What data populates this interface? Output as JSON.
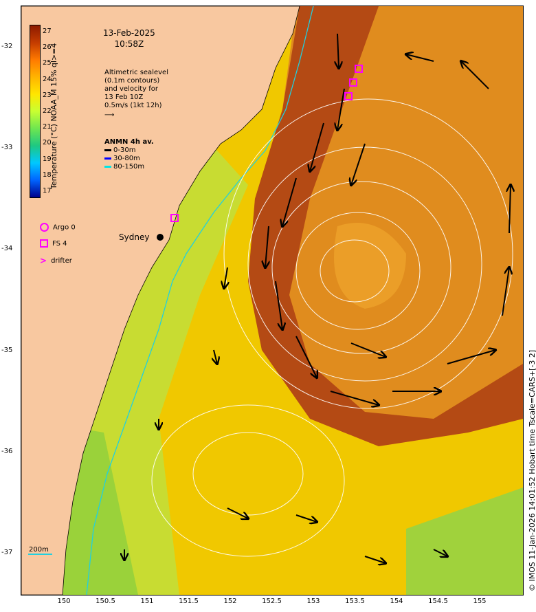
{
  "map": {
    "date": "13-Feb-2025",
    "time": "10:58Z",
    "altimetry_note": [
      "Altimetric sealevel",
      "(0.1m contours)",
      "and velocity for",
      "13 Feb 10Z",
      "0.5m/s (1kt 12h)"
    ],
    "anmn_title": "ANMN 4h av.",
    "anmn_items": [
      {
        "label": "0-30m",
        "color": "#000000"
      },
      {
        "label": "30-80m",
        "color": "#0000ff"
      },
      {
        "label": "80-150m",
        "color": "#00e5e5"
      }
    ],
    "legend": [
      {
        "label": "Argo 0",
        "icon": "circle-icon"
      },
      {
        "label": "FS 4",
        "icon": "square-icon"
      },
      {
        "label": "drifter",
        "icon": "chevron-right-icon"
      }
    ],
    "city_label": "Sydney",
    "depth_label": "200m",
    "credit": "© IMOS 11-Jan-2026 14:01:52 Hobart time Tscale=CARS+[-3 2]",
    "colorbar": {
      "title": "Temperature (°C) NOAA_M 15% ql>=4",
      "ticks": [
        "27",
        "26",
        "25",
        "24",
        "23",
        "22",
        "21",
        "20",
        "19",
        "18",
        "17"
      ]
    },
    "y_ticks": [
      "-32",
      "-33",
      "-34",
      "-35",
      "-36",
      "-37"
    ],
    "x_ticks": [
      "150",
      "150.5",
      "151",
      "151.5",
      "152",
      "152.5",
      "153",
      "153.5",
      "154",
      "154.5",
      "155"
    ],
    "colors": {
      "land": "#f8c8a0",
      "ocean_warm": "#c8641e",
      "ocean_mid": "#f0b400",
      "ocean_cool": "#c8dc32",
      "marker": "#ff00ff"
    }
  }
}
